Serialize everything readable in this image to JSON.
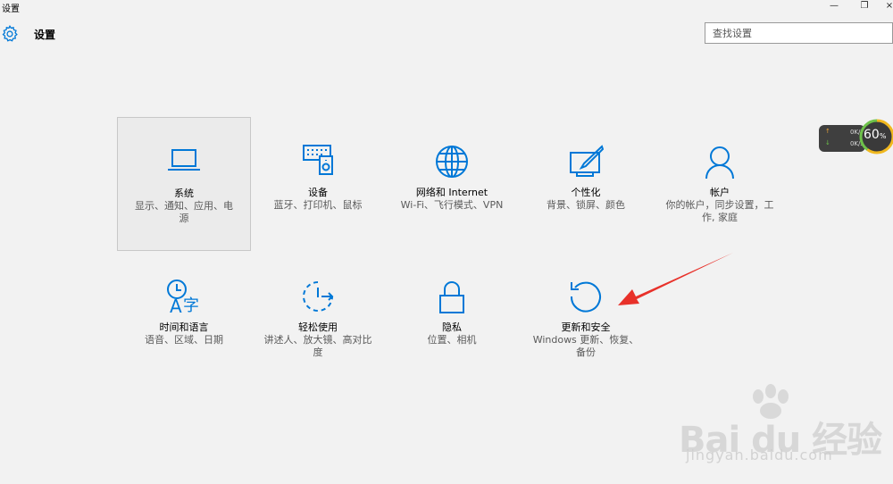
{
  "window": {
    "title": "设置",
    "controls": {
      "minimize": "—",
      "restore": "❐",
      "close": "×"
    }
  },
  "header": {
    "title": "设置",
    "icon": "gear-icon",
    "accent": "#0078d7"
  },
  "search": {
    "placeholder": "查找设置",
    "value": ""
  },
  "tiles": [
    {
      "title": "系统",
      "desc": "显示、通知、应用、电源",
      "icon": "laptop-icon",
      "selected": true
    },
    {
      "title": "设备",
      "desc": "蓝牙、打印机、鼠标",
      "icon": "devices-icon"
    },
    {
      "title": "网络和 Internet",
      "desc": "Wi-Fi、飞行模式、VPN",
      "icon": "globe-icon"
    },
    {
      "title": "个性化",
      "desc": "背景、锁屏、颜色",
      "icon": "personalization-icon"
    },
    {
      "title": "帐户",
      "desc": "你的帐户，同步设置，工作, 家庭",
      "icon": "person-icon"
    },
    {
      "title": "时间和语言",
      "desc": "语音、区域、日期",
      "icon": "time-language-icon"
    },
    {
      "title": "轻松使用",
      "desc": "讲述人、放大镜、高对比度",
      "icon": "ease-of-access-icon"
    },
    {
      "title": "隐私",
      "desc": "位置、相机",
      "icon": "lock-icon"
    },
    {
      "title": "更新和安全",
      "desc": "Windows 更新、恢复、备份",
      "icon": "refresh-icon"
    }
  ],
  "net_widget": {
    "upload": "0K/s",
    "download": "0K/s",
    "percent": "60",
    "percent_unit": "%"
  },
  "watermark": {
    "main": "Bai du 经验",
    "sub": "jingyan.baidu.com"
  },
  "annotation": {
    "arrow_color": "#e8312a"
  }
}
